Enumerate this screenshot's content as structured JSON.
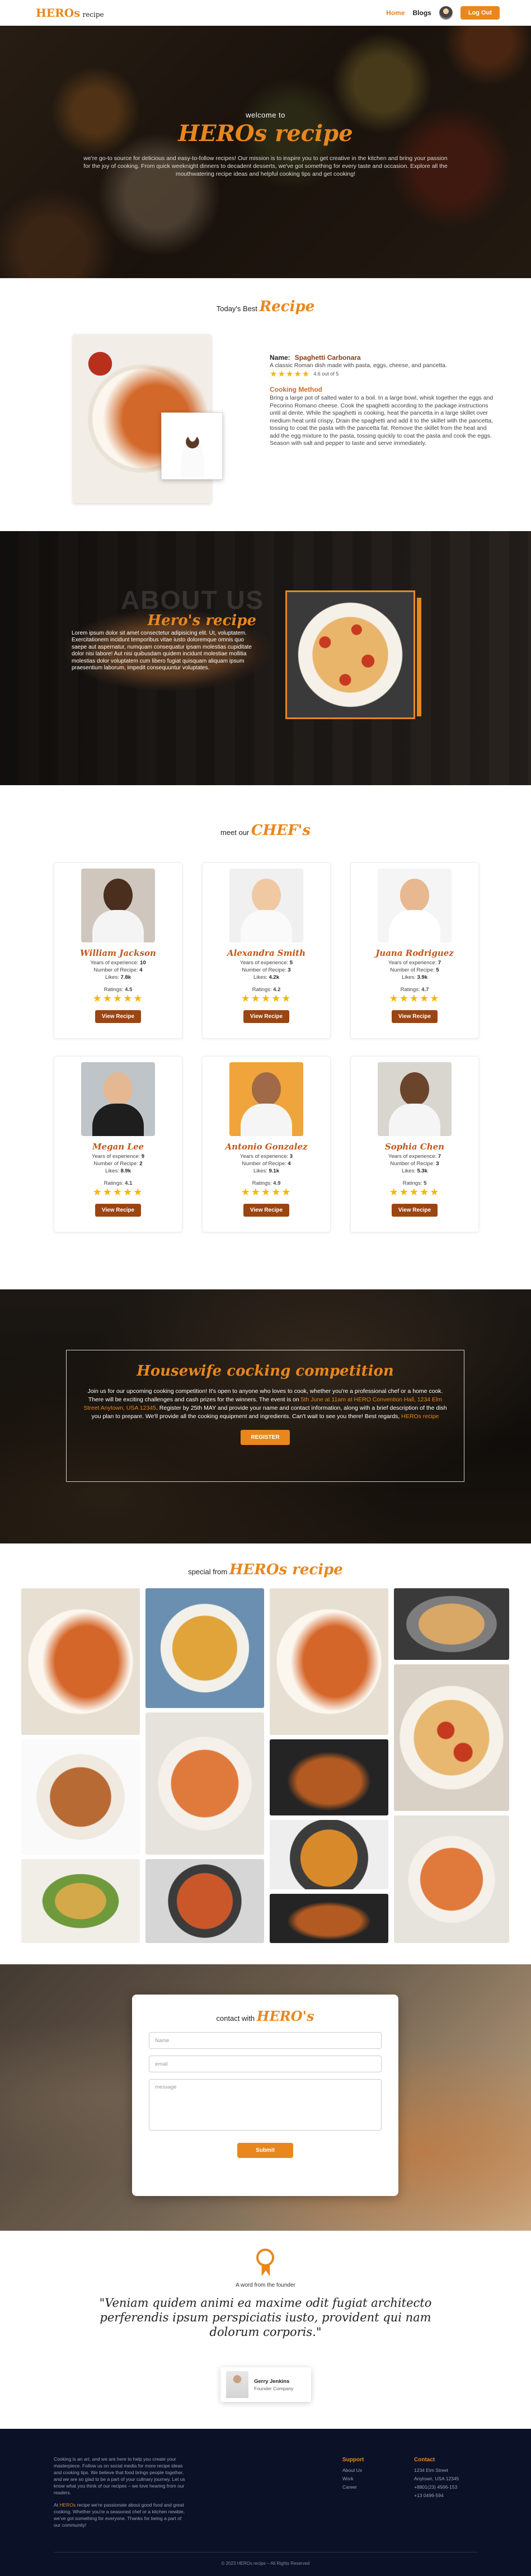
{
  "nav": {
    "logo_main": "HEROs",
    "logo_sub": "recipe",
    "links": [
      "Home",
      "Blogs"
    ],
    "login_label": "Log Out"
  },
  "hero": {
    "welcome": "welcome to",
    "title": "HEROs recipe",
    "text": "we're go-to source for delicious and easy-to-follow recipes! Our mission is to inspire you to get creative in the kitchen and bring your passion for the joy of cooking. From quick weeknight dinners to decadent desserts, we've got something for every taste and occasion. Explore all the mouthwatering recipe ideas and helpful cooking tips and get cooking!"
  },
  "today": {
    "label": "Today's Best",
    "title": "Recipe",
    "name_label": "Name:",
    "name": "Spaghetti Carbonara",
    "desc": "A classic Roman dish made with pasta, eggs, cheese, and pancetta.",
    "stars": "★★★★★",
    "rating_text": "4.6 out of 5",
    "method_title": "Cooking Method",
    "method": "Bring a large pot of salted water to a boil. In a large bowl, whisk together the eggs and Pecorino Romano cheese. Cook the spaghetti according to the package instructions until al dente. While the spaghetti is cooking, heat the pancetta in a large skillet over medium heat until crispy. Drain the spaghetti and add it to the skillet with the pancetta, tossing to coat the pasta with the pancetta fat. Remove the skillet from the heat and add the egg mixture to the pasta, tossing quickly to coat the pasta and cook the eggs. Season with salt and pepper to taste and serve immediately."
  },
  "about": {
    "bg_text": "ABOUT US",
    "title": "Hero's recipe",
    "text": "Lorem ipsum dolor sit amet consectetur adipisicing elit. Ut, voluptatem. Exercitationem incidunt temporibus vitae iusto doloremque omnis quo saepe aut aspernatur, numquam consequatur ipsam molestias cupiditate dolor nisi labore! Aut nisi quibusdam quidem incidunt molestiae mollitia molestias dolor voluptatem cum libero fugiat quisquam aliquam ipsum praesentium laborum, impedit consequuntur voluptates."
  },
  "chefs": {
    "label": "meet our",
    "title": "CHEF's",
    "years_label": "Years of experience:",
    "recipes_label": "Number of Recipe:",
    "likes_label": "Likes:",
    "ratings_label": "Ratings:",
    "button": "View Recipe",
    "items": [
      {
        "name": "William Jackson",
        "years": "10",
        "recipes": "4",
        "likes": "7.8k",
        "rating": "4.5",
        "stars": "★★★★★"
      },
      {
        "name": "Alexandra Smith",
        "years": "5",
        "recipes": "3",
        "likes": "4.2k",
        "rating": "4.2",
        "stars": "★★★★★"
      },
      {
        "name": "Juana Rodriguez",
        "years": "7",
        "recipes": "5",
        "likes": "3.9k",
        "rating": "4.7",
        "stars": "★★★★★"
      },
      {
        "name": "Megan Lee",
        "years": "9",
        "recipes": "2",
        "likes": "8.9k",
        "rating": "4.1",
        "stars": "★★★★★"
      },
      {
        "name": "Antonio Gonzalez",
        "years": "3",
        "recipes": "4",
        "likes": "9.1k",
        "rating": "4.9",
        "stars": "★★★★★"
      },
      {
        "name": "Sophia Chen",
        "years": "7",
        "recipes": "3",
        "likes": "5.3k",
        "rating": "5",
        "stars": "★★★★★"
      }
    ],
    "colors": {
      "name": "#c2561a",
      "button": "#9b4513",
      "star": "#f2b705"
    }
  },
  "competition": {
    "title": "Housewife cocking competition",
    "text_1": "Join us for our upcoming cooking competition! It's open to anyone who loves to cook, whether you're a professional chef or a home cook. There will be exciting challenges and cash prizes for the winners. The event is on",
    "date": "5th June at 11am at HERO Convention Hall, 1234 Elm Street Anytown, USA 12345",
    "text_2": ". Register by 25th MAY and provide your name and contact information, along with a brief description of the dish you plan to prepare. We'll provide all the cooking equipment and ingredients. Can't wait to see you there! Best regards,",
    "signoff": "HEROs recipe",
    "button": "REGISTER"
  },
  "gallery": {
    "label": "special from",
    "title": "HEROs recipe"
  },
  "contact": {
    "label": "contact with",
    "title": "HERO's",
    "name_placeholder": "Name",
    "email_placeholder": "email",
    "message_placeholder": "message",
    "submit": "Submit"
  },
  "testimonial": {
    "label": "A word from the founder",
    "quote": "\"Veniam quidem animi ea maxime odit fugiat architecto perferendis ipsum perspiciatis iusto, provident qui nam dolorum corporis.\"",
    "name": "Gerry Jenkins",
    "role": "Founder Company"
  },
  "footer": {
    "about_1": "Cooking is an art, and we are here to help you create your masterpiece. Follow us on social media for more recipe ideas and cooking tips. We believe that food brings people together, and we are so glad to be a part of your culinary journey. Let us know what you think of our recipes – we love hearing from our readers.",
    "about_2_prefix": "At",
    "about_2_brand": "HEROs",
    "about_2": "recipe we're passionate about good food and great cooking. Whether you're a seasoned chef or a kitchen newbie, we've got something for everyone. Thanks for being a part of our community!",
    "support_title": "Support",
    "support_items": [
      "About Us",
      "Work",
      "Career"
    ],
    "contact_title": "Contact",
    "contact_items": [
      "1234 Elm Street",
      "Anytown, USA 12345",
      "+8801(23) 4566-153",
      "+13 0496-594"
    ],
    "copyright": "© 2023 HEROs recipe – All Rights Reserved"
  }
}
